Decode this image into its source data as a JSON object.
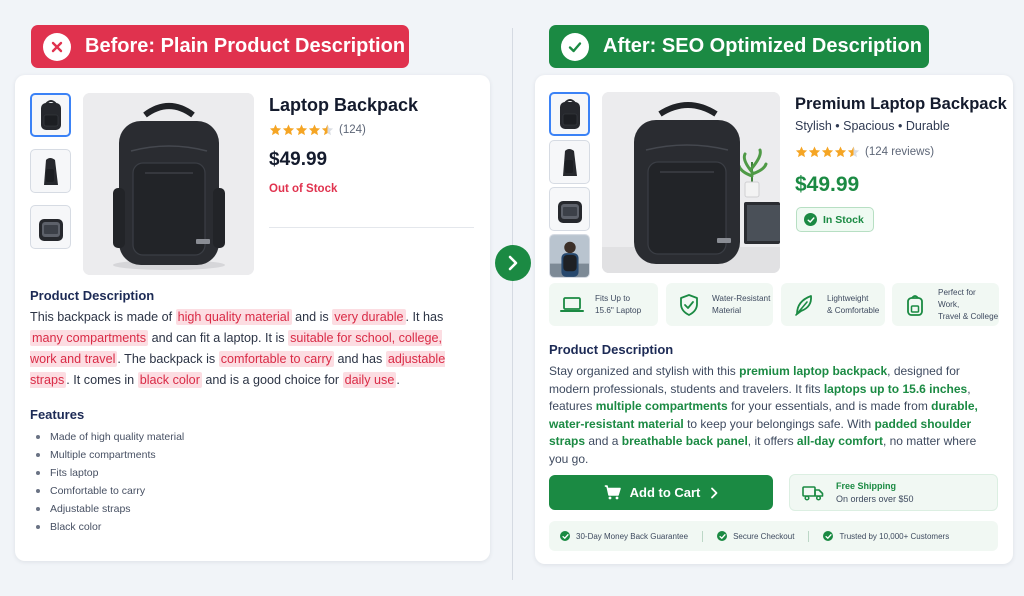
{
  "before": {
    "banner_title": "Before: Plain Product Description",
    "product_name": "Laptop Backpack",
    "rating_count": "(124)",
    "price": "$49.99",
    "stock_status": "Out of Stock",
    "description_heading": "Product Description",
    "description_segments": [
      {
        "text": "This backpack is made of ",
        "hl": false
      },
      {
        "text": "high quality material",
        "hl": true
      },
      {
        "text": " and is ",
        "hl": false
      },
      {
        "text": "very durable",
        "hl": true
      },
      {
        "text": ". It has ",
        "hl": false
      },
      {
        "text": "many compartments",
        "hl": true
      },
      {
        "text": " and can fit a laptop. It is ",
        "hl": false
      },
      {
        "text": "suitable for school, college, work and travel",
        "hl": true
      },
      {
        "text": ". The backpack is ",
        "hl": false
      },
      {
        "text": "comfortable to carry",
        "hl": true
      },
      {
        "text": " and has ",
        "hl": false
      },
      {
        "text": "adjustable straps",
        "hl": true
      },
      {
        "text": ". It comes in ",
        "hl": false
      },
      {
        "text": "black color",
        "hl": true
      },
      {
        "text": " and is a good choice for ",
        "hl": false
      },
      {
        "text": "daily use",
        "hl": true
      },
      {
        "text": ".",
        "hl": false
      }
    ],
    "features_heading": "Features",
    "features": [
      "Made of high quality material",
      "Multiple compartments",
      "Fits laptop",
      "Comfortable to carry",
      "Adjustable straps",
      "Black color"
    ]
  },
  "after": {
    "banner_title": "After: SEO Optimized Description",
    "product_name": "Premium Laptop Backpack",
    "subtitle": "Stylish • Spacious • Durable",
    "rating_count": "(124 reviews)",
    "price": "$49.99",
    "stock_status": "In Stock",
    "feature_boxes": [
      {
        "icon": "laptop-icon",
        "text": "Fits Up to\n15.6\" Laptop"
      },
      {
        "icon": "shield-icon",
        "text": "Water-Resistant\nMaterial"
      },
      {
        "icon": "feather-icon",
        "text": "Lightweight\n& Comfortable"
      },
      {
        "icon": "backpack-icon",
        "text": "Perfect for Work,\nTravel & College"
      }
    ],
    "description_heading": "Product Description",
    "description_segments": [
      {
        "text": "Stay organized and stylish with this ",
        "b": false
      },
      {
        "text": "premium laptop backpack",
        "b": true
      },
      {
        "text": ", designed for modern professionals, students and travelers. It fits ",
        "b": false
      },
      {
        "text": "laptops up to 15.6 inches",
        "b": true
      },
      {
        "text": ", features ",
        "b": false
      },
      {
        "text": "multiple compartments",
        "b": true
      },
      {
        "text": " for your essentials, and is made from ",
        "b": false
      },
      {
        "text": "durable, water-resistant material",
        "b": true
      },
      {
        "text": " to keep your belongings safe. With ",
        "b": false
      },
      {
        "text": "padded shoulder straps",
        "b": true
      },
      {
        "text": " and a ",
        "b": false
      },
      {
        "text": "breathable back panel",
        "b": true
      },
      {
        "text": ", it offers ",
        "b": false
      },
      {
        "text": "all-day comfort",
        "b": true
      },
      {
        "text": ", no matter where you go.",
        "b": false
      }
    ],
    "add_to_cart_label": "Add to Cart",
    "shipping_title": "Free Shipping",
    "shipping_subtitle": "On orders over $50",
    "trust_items": [
      "30-Day Money Back Guarantee",
      "Secure Checkout",
      "Trusted by 10,000+ Customers"
    ]
  },
  "rating_value": 4.5,
  "colors": {
    "before_accent": "#e0324e",
    "after_accent": "#1b8a43",
    "star": "#f5a524",
    "highlight_bg": "#fcdde2"
  }
}
